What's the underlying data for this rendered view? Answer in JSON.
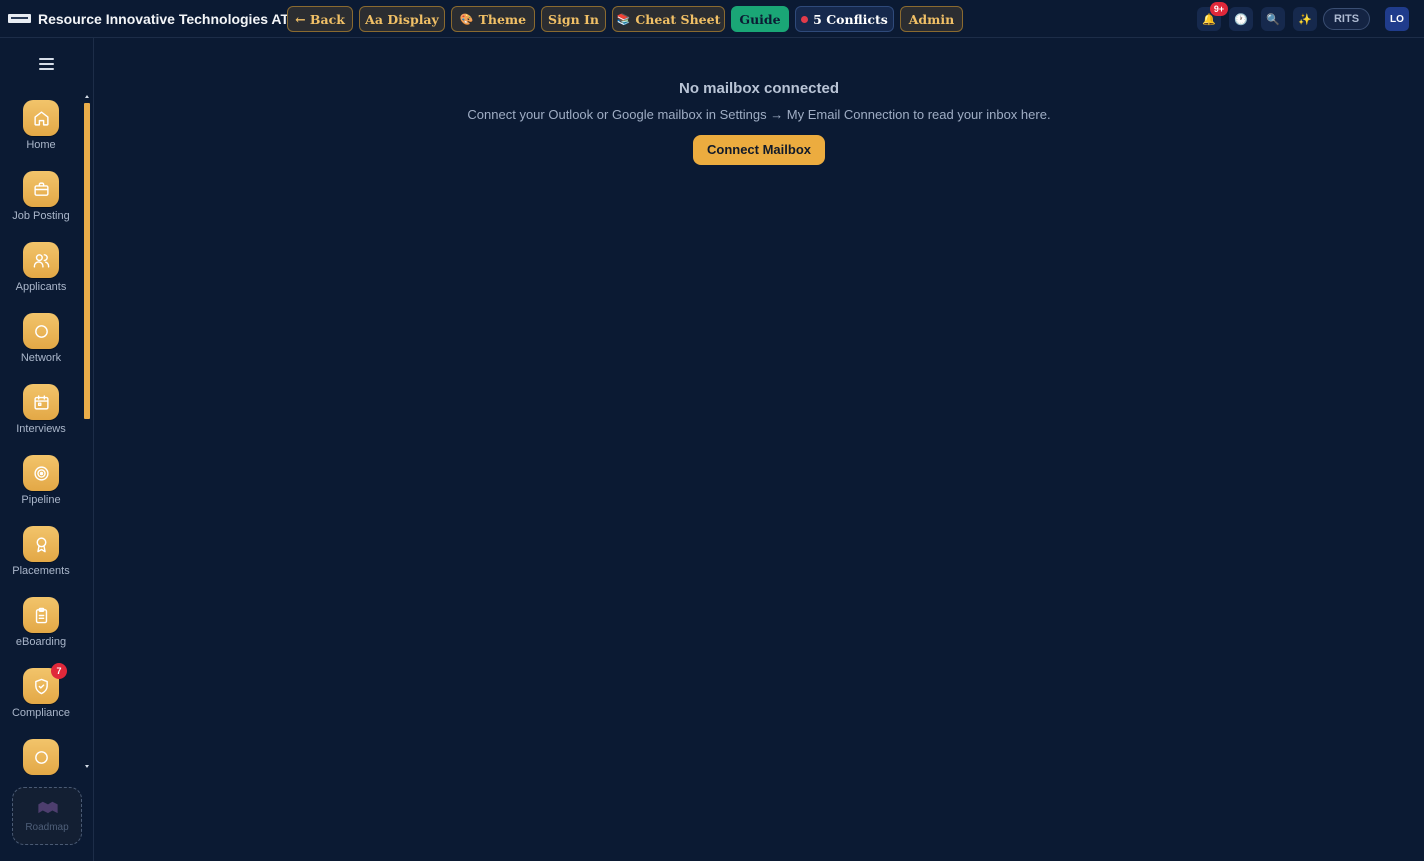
{
  "header": {
    "title": "Resource Innovative Technologies ATS",
    "buttons": {
      "back": "← Back",
      "display": "Aa Display",
      "theme": "Theme",
      "theme_icon": "🎨",
      "sign_in": "Sign In",
      "cheat_sheet": "Cheat Sheet",
      "cheat_sheet_icon": "📚",
      "guide": "Guide",
      "conflicts": "5 Conflicts",
      "admin": "Admin"
    },
    "notifications_badge": "9+",
    "icons": {
      "bell": "🔔",
      "clock": "🕐",
      "search": "🔍",
      "sparkle": "✨"
    },
    "org_chip": "RITS",
    "avatar_initials": "LO"
  },
  "sidebar": {
    "items": [
      {
        "label": "Home",
        "icon": "home-icon"
      },
      {
        "label": "Job Posting",
        "icon": "briefcase-icon"
      },
      {
        "label": "Applicants",
        "icon": "users-icon"
      },
      {
        "label": "Network",
        "icon": "circle-icon"
      },
      {
        "label": "Interviews",
        "icon": "calendar-icon"
      },
      {
        "label": "Pipeline",
        "icon": "target-icon"
      },
      {
        "label": "Placements",
        "icon": "award-icon"
      },
      {
        "label": "eBoarding",
        "icon": "clipboard-icon"
      },
      {
        "label": "Compliance",
        "icon": "shield-check-icon",
        "badge": "7"
      },
      {
        "label": "",
        "icon": "circle-icon"
      }
    ],
    "roadmap_label": "Roadmap"
  },
  "main": {
    "empty_title": "No mailbox connected",
    "empty_description": "Connect your Outlook or Google mailbox in Settings → My Email Connection to read your inbox here.",
    "connect_button": "Connect Mailbox"
  },
  "colors": {
    "background": "#0b1a33",
    "accent": "#ecac3f",
    "guide": "#1aa676",
    "badge": "#e0283a"
  }
}
